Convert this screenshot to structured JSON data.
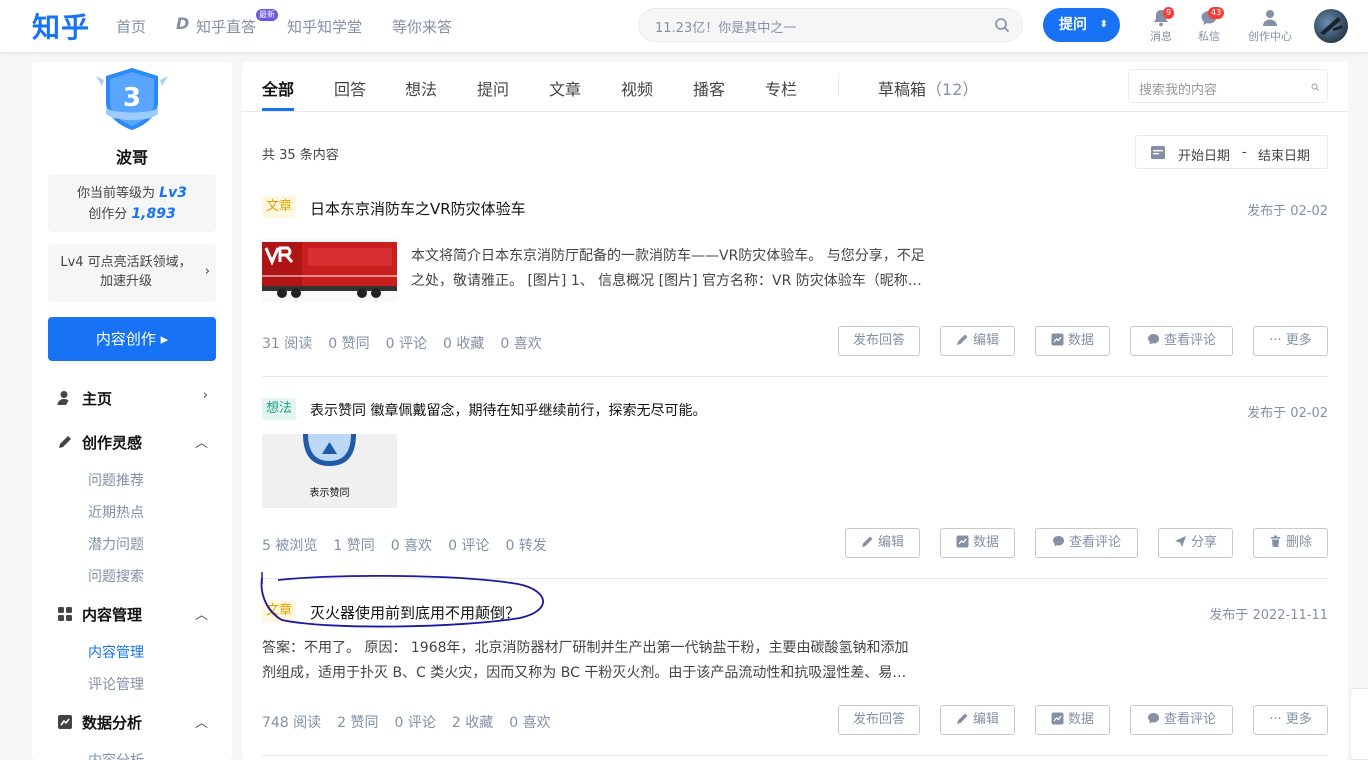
{
  "topbar": {
    "logo": "知乎",
    "nav": [
      "首页",
      "知乎直答",
      "知乎知学堂",
      "等你来答"
    ],
    "nav_badge": "最新",
    "search_placeholder": "11.23亿！你是其中之一",
    "ask_label": "提问",
    "messages_label": "消息",
    "messages_count": "9",
    "dm_label": "私信",
    "dm_count": "43",
    "creator_label": "创作中心"
  },
  "sidebar": {
    "level_number": "3",
    "username": "波哥",
    "level_text": "你当前等级为",
    "level_value": "Lv3",
    "score_text": "创作分",
    "score_value": "1,893",
    "upgrade_text": "Lv4 可点亮活跃领域，加速升级",
    "create_label": "内容创作 ▸",
    "sections": {
      "home": "主页",
      "inspiration": "创作灵感",
      "content": "内容管理",
      "analytics": "数据分析"
    },
    "inspiration_items": [
      "问题推荐",
      "近期热点",
      "潜力问题",
      "问题搜索"
    ],
    "content_items": [
      "内容管理",
      "评论管理"
    ],
    "analytics_items": [
      "内容分析"
    ]
  },
  "main": {
    "tabs": [
      "全部",
      "回答",
      "想法",
      "提问",
      "文章",
      "视频",
      "播客",
      "专栏"
    ],
    "drafts_label": "草稿箱",
    "drafts_count": "（12）",
    "search_placeholder": "搜索我的内容",
    "total": "共 35 条内容",
    "date_start": "开始日期",
    "date_sep": "-",
    "date_end": "结束日期",
    "items": [
      {
        "tag": "文章",
        "title": "日本东京消防车之VR防灾体验车",
        "published": "发布于 02-02",
        "excerpt_line1": "本文将简介日本东京消防厅配备的一款消防车——VR防灾体验车。 与您分享，不足",
        "excerpt_line2": "之处，敬请雅正。 [图片] 1、 信息概况 [图片] 官方名称：VR 防灾体验车（昵称…",
        "stats": [
          "31 阅读",
          "0 赞同",
          "0 评论",
          "0 收藏",
          "0 喜欢"
        ],
        "buttons": [
          "发布回答",
          "编辑",
          "数据",
          "查看评论",
          "更多"
        ]
      },
      {
        "tag": "想法",
        "title": "表示赞同 徽章佩戴留念，期待在知乎继续前行，探索无尽可能。",
        "published": "发布于 02-02",
        "thumb_caption": "表示赞同",
        "stats": [
          "5 被浏览",
          "1 赞同",
          "0 喜欢",
          "0 评论",
          "0 转发"
        ],
        "buttons": [
          "编辑",
          "数据",
          "查看评论",
          "分享",
          "删除"
        ]
      },
      {
        "tag": "文章",
        "title": "灭火器使用前到底用不用颠倒？",
        "published": "发布于 2022-11-11",
        "excerpt_line1": "答案：不用了。 原因： 1968年，北京消防器材厂研制并生产出第一代钠盐干粉，主要由碳酸氢钠和添加",
        "excerpt_line2": "剂组成，适用于扑灭 B、C 类火灾，因而又称为 BC 干粉灭火剂。由于该产品流动性和抗吸湿性差、易…",
        "stats": [
          "748 阅读",
          "2 赞同",
          "0 评论",
          "2 收藏",
          "0 喜欢"
        ],
        "buttons": [
          "发布回答",
          "编辑",
          "数据",
          "查看评论",
          "更多"
        ]
      }
    ]
  },
  "colors": {
    "brand_blue": "#1772f6",
    "badge_red": "#f1403c",
    "article_tag": "#e5a000",
    "idea_tag": "#1aa680",
    "annotation": "#1a1aa0"
  }
}
